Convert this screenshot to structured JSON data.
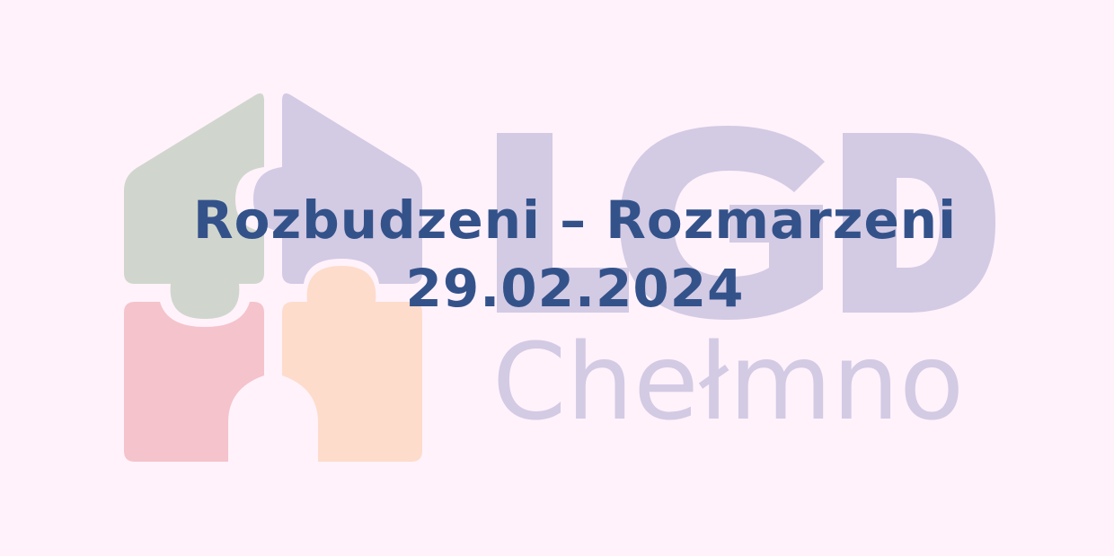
{
  "event": {
    "title": "Rozbudzeni – Rozmarzeni",
    "date": "29.02.2024"
  },
  "logo": {
    "mark": "LGD",
    "town": "Chełmno"
  },
  "colors": {
    "background": "#fff2fb",
    "text": "#34528a",
    "puzzle_green": "#d0d6cd",
    "puzzle_purple": "#d3cae4",
    "puzzle_pink": "#f5c3cb",
    "puzzle_peach": "#fddccb",
    "wordmark": "#d3cae4"
  }
}
